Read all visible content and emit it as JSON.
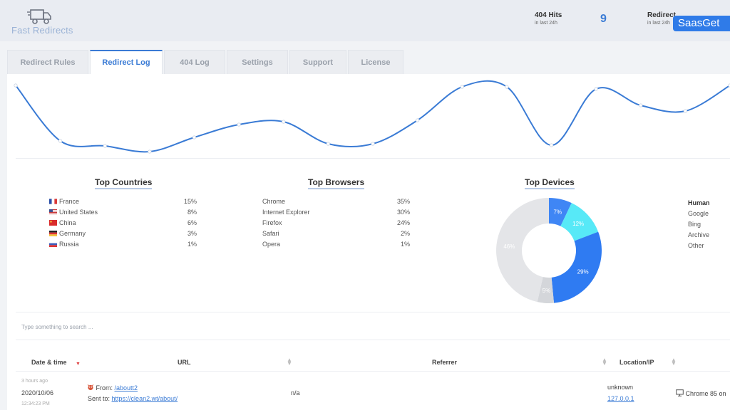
{
  "app": {
    "logo_text": "Fast Redirects",
    "watermark": "SaasGet"
  },
  "header": {
    "hits_title": "404 Hits",
    "hits_sub": "in last 24h",
    "hits_value": "9",
    "redirects_title": "Redirect",
    "redirects_sub": "in last 24h"
  },
  "tabs": [
    {
      "label": "Redirect Rules",
      "active": false
    },
    {
      "label": "Redirect Log",
      "active": true
    },
    {
      "label": "404 Log",
      "active": false
    },
    {
      "label": "Settings",
      "active": false
    },
    {
      "label": "Support",
      "active": false
    },
    {
      "label": "License",
      "active": false
    }
  ],
  "line_chart": {
    "color": "#3a7bd5",
    "values": [
      96,
      18,
      11,
      3,
      23,
      41,
      45,
      14,
      14,
      47,
      94,
      94,
      12,
      91,
      68,
      60,
      96
    ]
  },
  "top_countries": {
    "title": "Top Countries",
    "items": [
      {
        "name": "France",
        "pct": "15%",
        "flag": "fr-flag"
      },
      {
        "name": "United States",
        "pct": "8%",
        "flag": "us-flag"
      },
      {
        "name": "China",
        "pct": "6%",
        "flag": "cn-flag"
      },
      {
        "name": "Germany",
        "pct": "3%",
        "flag": "de-flag"
      },
      {
        "name": "Russia",
        "pct": "1%",
        "flag": "ru-flag"
      }
    ]
  },
  "top_browsers": {
    "title": "Top Browsers",
    "items": [
      {
        "name": "Chrome",
        "pct": "35%"
      },
      {
        "name": "Internet Explorer",
        "pct": "30%"
      },
      {
        "name": "Firefox",
        "pct": "24%"
      },
      {
        "name": "Safari",
        "pct": "2%"
      },
      {
        "name": "Opera",
        "pct": "1%"
      }
    ]
  },
  "top_devices": {
    "title": "Top Devices",
    "labels": [
      "Human",
      "Google",
      "Bing",
      "Archive",
      "Other"
    ],
    "segments": [
      {
        "label": "7%",
        "value": 7,
        "color": "#3f86f5"
      },
      {
        "label": "12%",
        "value": 12,
        "color": "#57e9f7"
      },
      {
        "label": "29%",
        "value": 29,
        "color": "#2f7bf2"
      },
      {
        "label": "5%",
        "value": 5,
        "color": "#d4d6da"
      },
      {
        "label": "46%",
        "value": 46,
        "color": "#e4e5e8"
      }
    ]
  },
  "search": {
    "placeholder": "Type something to search ..."
  },
  "table": {
    "headers": {
      "date": "Date & time",
      "url": "URL",
      "referrer": "Referrer",
      "location": "Location/IP"
    },
    "rows": [
      {
        "ago": "3 hours ago",
        "date": "2020/10/06",
        "time": "12:34:23 PM",
        "from_label": "From:",
        "from_url": "/aboutt2",
        "sent_label": "Sent to:",
        "sent_url": "https://clean2.wt/about/",
        "referrer": "n/a",
        "location": "unknown",
        "ip": "127.0.0.1",
        "agent": "Chrome 85 on"
      }
    ]
  }
}
